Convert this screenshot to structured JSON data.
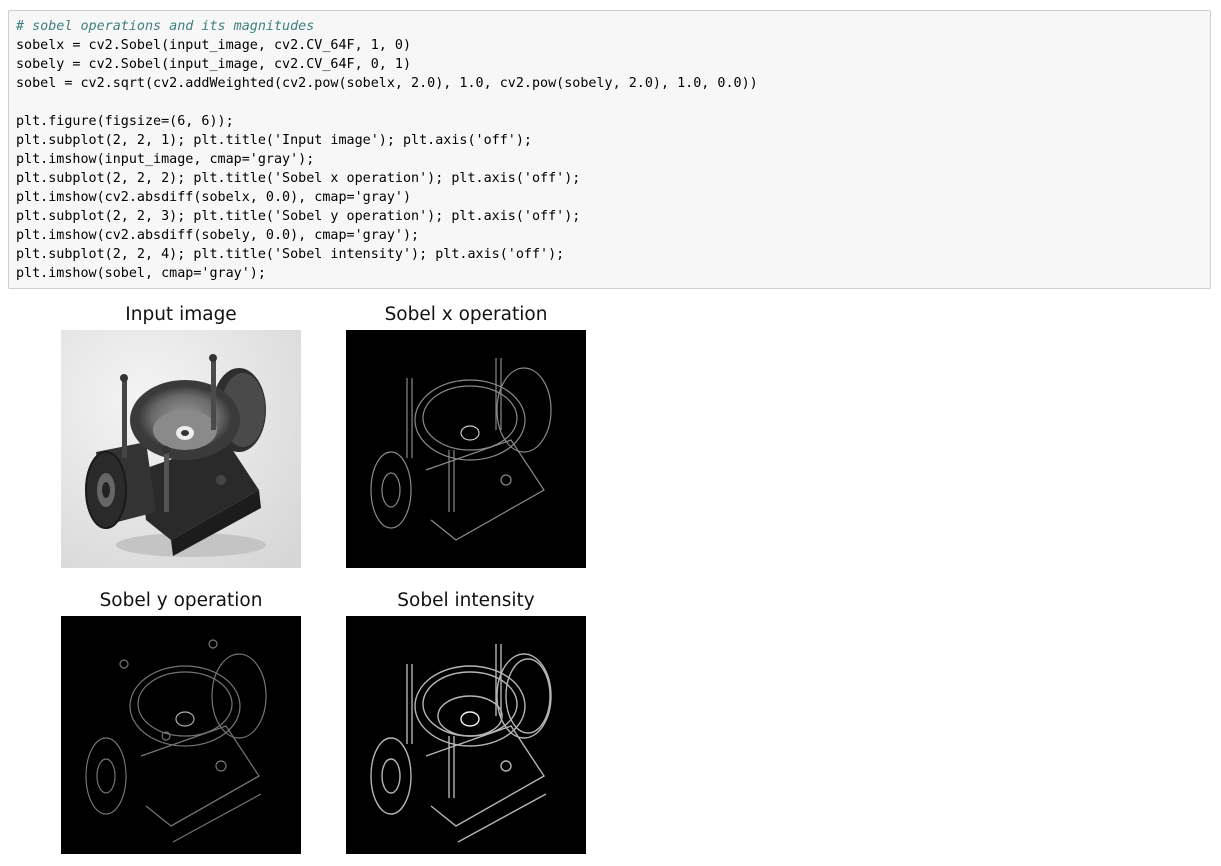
{
  "code_cell": {
    "lines": [
      "# sobel operations and its magnitudes",
      "sobelx = cv2.Sobel(input_image, cv2.CV_64F, 1, 0)",
      "sobely = cv2.Sobel(input_image, cv2.CV_64F, 0, 1)",
      "sobel = cv2.sqrt(cv2.addWeighted(cv2.pow(sobelx, 2.0), 1.0, cv2.pow(sobely, 2.0), 1.0, 0.0))",
      "",
      "plt.figure(figsize=(6, 6));",
      "plt.subplot(2, 2, 1); plt.title('Input image'); plt.axis('off');",
      "plt.imshow(input_image, cmap='gray');",
      "plt.subplot(2, 2, 2); plt.title('Sobel x operation'); plt.axis('off');",
      "plt.imshow(cv2.absdiff(sobelx, 0.0), cmap='gray')",
      "plt.subplot(2, 2, 3); plt.title('Sobel y operation'); plt.axis('off');",
      "plt.imshow(cv2.absdiff(sobely, 0.0), cmap='gray');",
      "plt.subplot(2, 2, 4); plt.title('Sobel intensity'); plt.axis('off');",
      "plt.imshow(sobel, cmap='gray');"
    ]
  },
  "output": {
    "panels": [
      {
        "title": "Input image"
      },
      {
        "title": "Sobel x operation"
      },
      {
        "title": "Sobel y operation"
      },
      {
        "title": "Sobel intensity"
      }
    ]
  }
}
